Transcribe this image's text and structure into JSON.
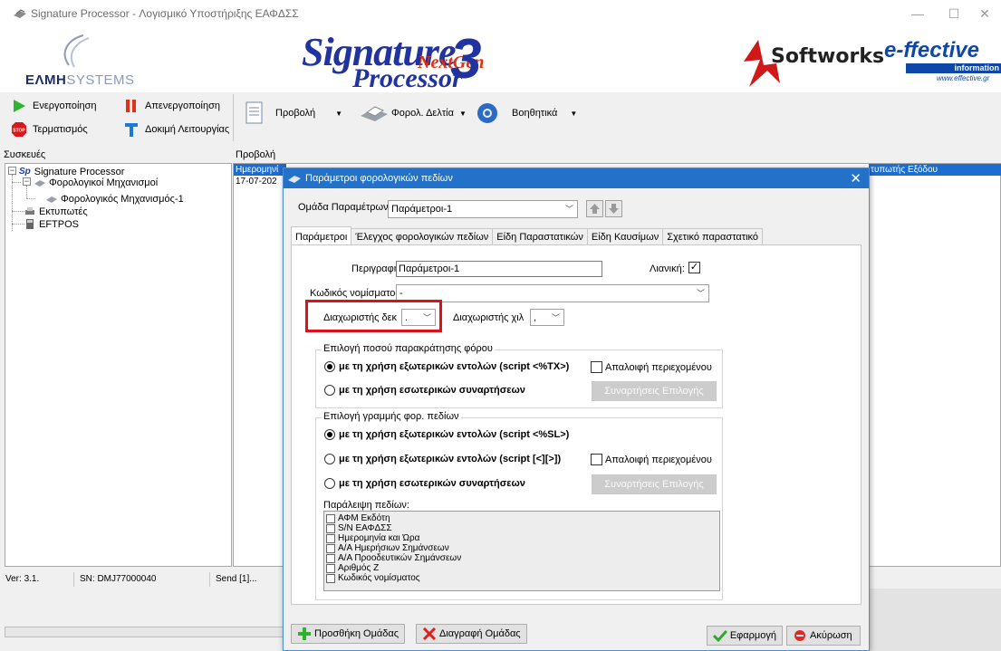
{
  "window": {
    "title": "Signature Processor - Λογισμικό Υποστήριξης ΕΑΦΔΣΣ",
    "minimize": "—",
    "maximize": "☐",
    "close": "✕"
  },
  "banner": {
    "elmh_bold": "EΛMH",
    "elmh_light": "SYSTEMS",
    "logo_line1": "Signature",
    "logo_nextgen": "NextGen",
    "logo_line2": "Processor",
    "logo_version": "3",
    "softworks": "Softworks",
    "effective_brand": "e-ffective",
    "effective_sub": "information technologies",
    "effective_url": "www.effective.gr"
  },
  "toolbar": {
    "activate": "Ενεργοποίηση",
    "deactivate": "Απενεργοποίηση",
    "terminate": "Τερματισμός",
    "test_operation": "Δοκιμή Λειτουργίας",
    "menu_view": "Προβολή",
    "menu_tax_receipts": "Φορολ. Δελτία",
    "menu_help": "Βοηθητικά"
  },
  "panels": {
    "devices": "Συσκευές",
    "view": "Προβολή"
  },
  "tree": {
    "root": "Signature Processor",
    "fiscal_devices": "Φορολογικοί Μηχανισμοί",
    "fiscal_device_1": "Φορολογικός Μηχανισμός-1",
    "printers": "Εκτυπωτές",
    "eftpos": "EFTPOS"
  },
  "view": {
    "col_date": "Ημερομηνί",
    "col_output_printer": "τυπωτής Εξόδου",
    "row1_date": "17-07-202"
  },
  "statusbar": {
    "version": "Ver: 3.1.",
    "serial": "SN: DMJ77000040",
    "send": "Send [1]..."
  },
  "dialog": {
    "title": "Παράμετροι φορολογικών πεδίων",
    "group_label": "Ομάδα Παραμέτρων",
    "group_value": "Παράμετροι-1",
    "tabs": [
      "Παράμετροι",
      "Έλεγχος φορολογικών πεδίων",
      "Είδη Παραστατικών",
      "Είδη Καυσίμων",
      "Σχετικό παραστατικό"
    ],
    "description_label": "Περιγραφή:",
    "description_value": "Παράμετροι-1",
    "retail_label": "Λιανική:",
    "retail_checked": "✓",
    "currency_label": "Κωδικός νομίσματος:",
    "currency_value": "-",
    "decimal_sep_label": "Διαχωριστής δεκ",
    "decimal_sep_value": ".",
    "thousand_sep_label": "Διαχωριστής χιλ",
    "thousand_sep_value": ",",
    "withholding_group": "Επιλογή ποσού παρακράτησης φόρου",
    "withholding_external": "με τη χρήση εξωτερικών εντολών (script <%TX>)",
    "withholding_clear": "Απαλοιφή περιεχομένου",
    "withholding_internal": "με τη χρήση εσωτερικών συναρτήσεων",
    "withholding_func_btn": "Συναρτήσεις Επιλογής",
    "fiscal_line_group": "Επιλογή γραμμής φορ. πεδίων",
    "fiscal_line_opt1": "με τη χρήση εξωτερικών εντολών (script <%SL>)",
    "fiscal_line_opt2": "με τη χρήση εξωτερικών εντολών (script [<][>])",
    "fiscal_line_clear": "Απαλοιφή περιεχομένου",
    "fiscal_line_opt3": "με τη χρήση εσωτερικών συναρτήσεων",
    "fiscal_line_func_btn": "Συναρτήσεις Επιλογής",
    "skip_fields_label": "Παράλειψη πεδίων:",
    "skip_fields": [
      "ΑΦΜ Εκδότη",
      "S/N ΕΑΦΔΣΣ",
      "Ημερομηνία και Ώρα",
      "Α/Α Ημερήσιων Σημάνσεων",
      "Α/Α Προοδευτικών Σημάνσεων",
      "Αριθμός Ζ",
      "Κωδικός νομίσματος"
    ],
    "add_group": "Προσθήκη Ομάδας",
    "delete_group": "Διαγραφή Ομάδας",
    "apply": "Εφαρμογή",
    "cancel": "Ακύρωση"
  },
  "colors": {
    "dialog_title_bg": "#2371c9",
    "highlight_border": "#e0101a",
    "selection_bg": "#1c6dd0"
  }
}
